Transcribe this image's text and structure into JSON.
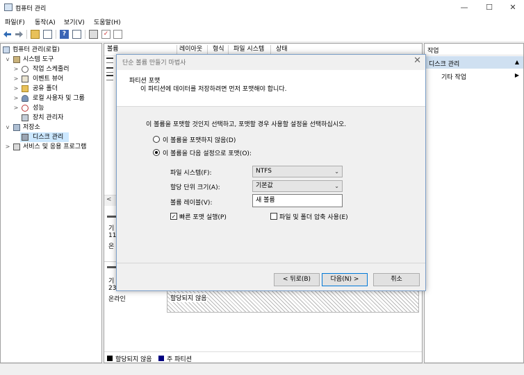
{
  "window": {
    "title": "컴퓨터 관리",
    "minimize": "—",
    "maximize": "☐",
    "close": "✕"
  },
  "menu": [
    "파일(F)",
    "동작(A)",
    "보기(V)",
    "도움말(H)"
  ],
  "tree": {
    "root": "컴퓨터 관리(로컬)",
    "system_tools": "시스템 도구",
    "task_scheduler": "작업 스케줄러",
    "event_viewer": "이벤트 뷰어",
    "shared_folders": "공유 폴더",
    "local_users": "로컬 사용자 및 그룹",
    "performance": "성능",
    "device_manager": "장치 관리자",
    "storage": "저장소",
    "disk_management": "디스크 관리",
    "services": "서비스 및 응용 프로그램"
  },
  "center": {
    "columns": [
      "볼륨",
      "레이아웃",
      "형식",
      "파일 시스템",
      "상태"
    ],
    "disk1": {
      "line1": "기",
      "line2": "11",
      "line3": "온"
    },
    "disk2": {
      "line1": "기",
      "line2": "23",
      "line3": "온라인"
    },
    "unallocated_label": "할당되지 않음",
    "scroll_left": "<",
    "legend": {
      "unallocated": "할당되지 않음",
      "primary": "주 파티션"
    }
  },
  "actions": {
    "header": "작업",
    "section": "디스크 관리",
    "more": "기타 작업"
  },
  "dialog": {
    "title": "단순 볼륨 만들기 마법사",
    "close": "✕",
    "heading": "파티션 포맷",
    "subheading": "이 파티션에 데이터를 저장하려면 먼저 포맷해야 합니다.",
    "instruction": "이 볼륨을 포맷할 것인지 선택하고, 포맷할 경우 사용할 설정을 선택하십시오.",
    "radio_no_format": "이 볼륨을 포맷하지 않음(D)",
    "radio_format": "이 볼륨을 다음 설정으로 포맷(O):",
    "fs_label": "파일 시스템(F):",
    "fs_value": "NTFS",
    "alloc_label": "할당 단위 크기(A):",
    "alloc_value": "기본값",
    "volume_label": "볼륨 레이블(V):",
    "volume_value": "새 볼륨",
    "quick_format": "빠른 포맷 실행(P)",
    "compression": "파일 및 폴더 압축 사용(E)",
    "back": "< 뒤로(B)",
    "next": "다음(N) >",
    "cancel": "취소"
  },
  "colors": {
    "accent": "#0078d7",
    "selection": "#cce8ff",
    "primary_partition": "#000080"
  }
}
